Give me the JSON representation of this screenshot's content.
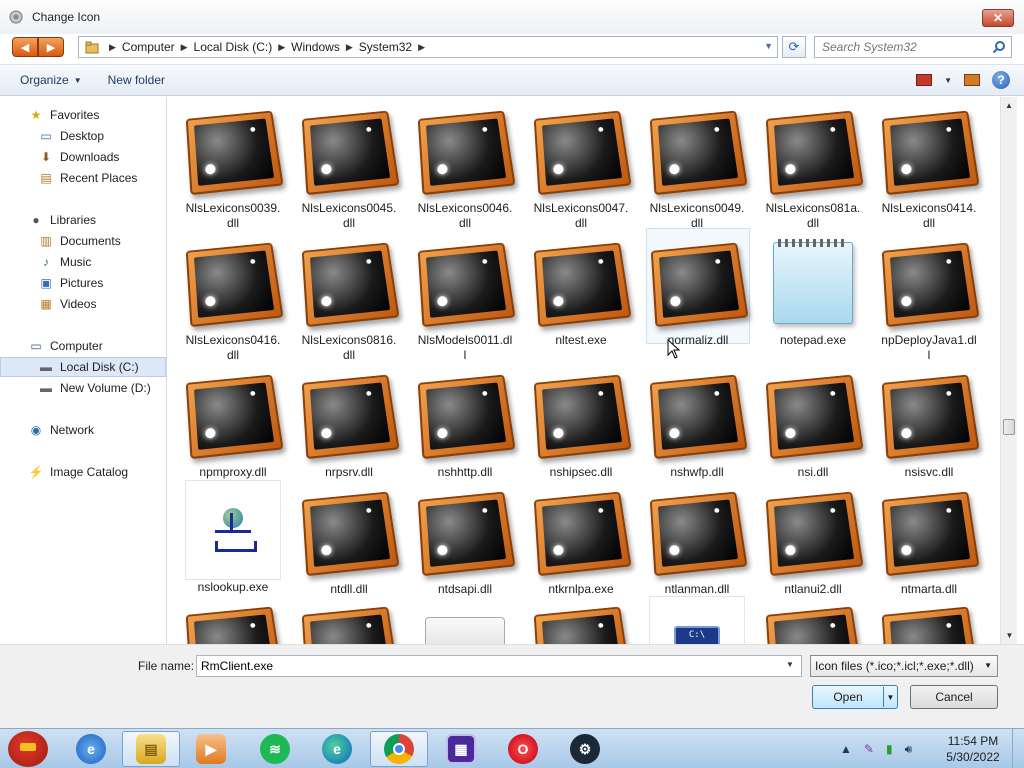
{
  "window": {
    "title": "Change Icon",
    "close_label": "✕"
  },
  "address": {
    "crumbs": [
      "Computer",
      "Local Disk (C:)",
      "Windows",
      "System32"
    ],
    "search_placeholder": "Search System32"
  },
  "toolbar": {
    "organize_label": "Organize",
    "new_folder_label": "New folder",
    "help_label": "?"
  },
  "navpane": {
    "favorites": {
      "label": "Favorites",
      "items": [
        "Desktop",
        "Downloads",
        "Recent Places"
      ]
    },
    "libraries": {
      "label": "Libraries",
      "items": [
        "Documents",
        "Music",
        "Pictures",
        "Videos"
      ]
    },
    "computer": {
      "label": "Computer",
      "items": [
        "Local Disk (C:)",
        "New Volume (D:)"
      ]
    },
    "network": {
      "label": "Network"
    },
    "image_catalog": {
      "label": "Image Catalog"
    }
  },
  "files": {
    "row1": [
      "NlsLexicons0039.dll",
      "NlsLexicons0045.dll",
      "NlsLexicons0046.dll",
      "NlsLexicons0047.dll",
      "NlsLexicons0049.dll",
      "NlsLexicons081a.dll",
      "NlsLexicons0414.dll"
    ],
    "row2": [
      "NlsLexicons0416.dll",
      "NlsLexicons0816.dll",
      "NlsModels0011.dll",
      "nltest.exe",
      "normaliz.dll",
      "notepad.exe",
      "npDeployJava1.dll"
    ],
    "row3": [
      "npmproxy.dll",
      "nrpsrv.dll",
      "nshhttp.dll",
      "nshipsec.dll",
      "nshwfp.dll",
      "nsi.dll",
      "nsisvc.dll"
    ],
    "row4": [
      "nslookup.exe",
      "ntdll.dll",
      "ntdsapi.dll",
      "ntkrnlpa.exe",
      "ntlanman.dll",
      "ntlanui2.dll",
      "ntmarta.dll"
    ]
  },
  "bottom": {
    "file_name_label": "File name:",
    "file_name_value": "RmClient.exe",
    "filter_value": "Icon files (*.ico;*.icl;*.exe;*.dll)",
    "open_label": "Open",
    "cancel_label": "Cancel"
  },
  "taskbar": {
    "time": "11:54 PM",
    "date": "5/30/2022"
  },
  "icons": {
    "dll": "dll-file-icon",
    "notepad": "notepad-icon",
    "nslookup": "network-tree-icon"
  }
}
